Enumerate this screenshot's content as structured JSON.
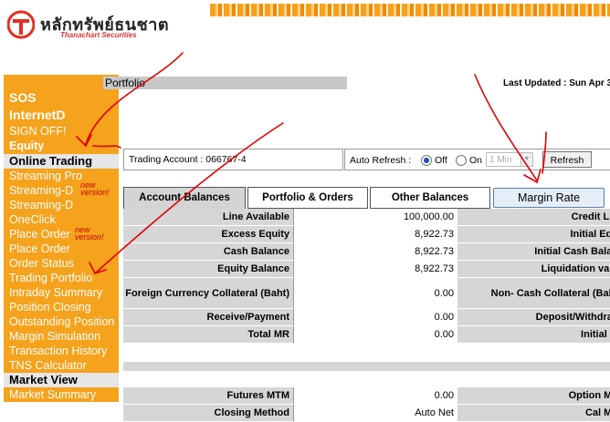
{
  "header": {
    "brand_thai": "หลักทรัพย์ธนชาต",
    "brand_en": "Thanachart Securities"
  },
  "sidebar": {
    "top_items": [
      "SOS",
      "InternetD",
      "SIGN OFF!",
      "Equity"
    ],
    "section_online": "Online Trading",
    "items": [
      {
        "label": "Streaming Pro",
        "badge": ""
      },
      {
        "label": "Streaming-D",
        "badge": "new version!"
      },
      {
        "label": "Streaming-D",
        "badge": ""
      },
      {
        "label": "OneClick",
        "badge": ""
      },
      {
        "label": "Place Order",
        "badge": "new version!"
      },
      {
        "label": "Place Order",
        "badge": ""
      },
      {
        "label": "Order Status",
        "badge": ""
      },
      {
        "label": "Trading Portfolio",
        "badge": ""
      },
      {
        "label": "Intraday Summary",
        "badge": ""
      },
      {
        "label": "Position Closing",
        "badge": ""
      },
      {
        "label": "Outstanding Position",
        "badge": ""
      },
      {
        "label": "Margin Simulation",
        "badge": ""
      },
      {
        "label": "Transaction History",
        "badge": ""
      },
      {
        "label": "TNS Calculator",
        "badge": ""
      }
    ],
    "section_market": "Market View",
    "market_items": [
      "Market Summary"
    ]
  },
  "page_title": "Portfolio",
  "last_updated": "Last Updated : Sun Apr 3",
  "account": {
    "label": "Trading Account : 066767-4"
  },
  "auto_refresh": {
    "label": "Auto Refresh :",
    "off_label": "Off",
    "on_label": "On",
    "selected": "Off",
    "interval": "1 Min",
    "button": "Refresh"
  },
  "tabs": [
    "Account Balances",
    "Portfolio & Orders",
    "Other Balances",
    "Margin Rate"
  ],
  "balances": [
    {
      "label": "Line Available",
      "value": "100,000.00",
      "right_label": "Credit Lin"
    },
    {
      "label": "Excess Equity",
      "value": "8,922.73",
      "right_label": "Initial Equ"
    },
    {
      "label": "Cash Balance",
      "value": "8,922.73",
      "right_label": "Initial Cash Balan"
    },
    {
      "label": "Equity Balance",
      "value": "8,922.73",
      "right_label": "Liquidation valu"
    },
    {
      "label": "Foreign Currency Collateral (Baht)",
      "value": "0.00",
      "right_label": "Non- Cash Collateral (Baht"
    },
    {
      "label": "Receive/Payment",
      "value": "0.00",
      "right_label": "Deposit/Withdrav"
    },
    {
      "label": "Total MR",
      "value": "0.00",
      "right_label": "Initial M"
    }
  ],
  "futures": [
    {
      "label": "Futures MTM",
      "value": "0.00",
      "right_label": "Option MT"
    },
    {
      "label": "Closing Method",
      "value": "Auto Net",
      "right_label": "Cal MT"
    }
  ],
  "colors": {
    "sidebar_bg": "#f5a21c",
    "annotation_red": "#e00000",
    "badge_red": "#cc0000"
  }
}
